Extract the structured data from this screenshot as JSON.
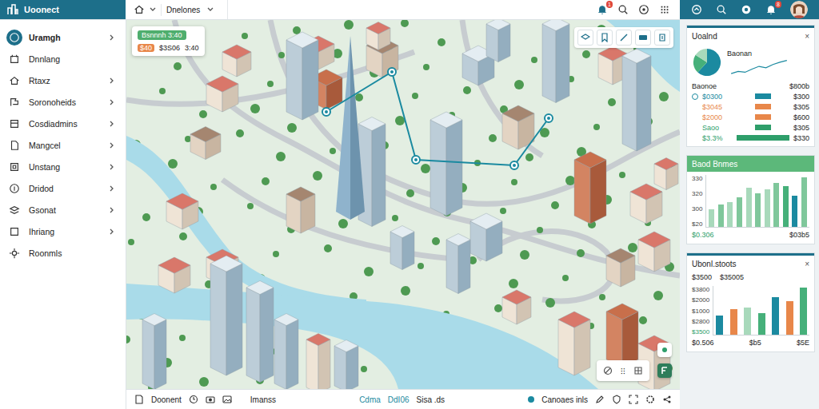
{
  "app": {
    "logo": "Uoonect"
  },
  "breadcrumb": {
    "label": "Dnelones"
  },
  "topbar": {
    "badges": [
      "1",
      "8"
    ]
  },
  "sidebar": {
    "items": [
      {
        "label": "Uramgh",
        "selected": true,
        "expandable": true
      },
      {
        "label": "Dnnlang",
        "selected": false,
        "expandable": false
      },
      {
        "label": "Rtaxz",
        "selected": false,
        "expandable": true
      },
      {
        "label": "Soronoheids",
        "selected": false,
        "expandable": true
      },
      {
        "label": "Cosdiadmins",
        "selected": false,
        "expandable": true
      },
      {
        "label": "Mangcel",
        "selected": false,
        "expandable": true
      },
      {
        "label": "Unstang",
        "selected": false,
        "expandable": true
      },
      {
        "label": "Dridod",
        "selected": false,
        "expandable": true
      },
      {
        "label": "Gsonat",
        "selected": false,
        "expandable": true
      },
      {
        "label": "Ihriang",
        "selected": false,
        "expandable": true
      },
      {
        "label": "Roonmls",
        "selected": false,
        "expandable": false
      }
    ]
  },
  "map": {
    "info_card": {
      "pill": "Bsnnnh 3:40",
      "badge": "$40",
      "info": "$3S06",
      "time": "3:40"
    },
    "legend_card": {
      "label": "⁝⁝"
    }
  },
  "bottom_bar": {
    "doc_label": "Doonent",
    "view_label": "Imanss",
    "status": [
      {
        "label": "Cdma",
        "accent": true
      },
      {
        "label": "DdI06",
        "accent": true
      },
      {
        "label": "Sisa .ds",
        "accent": false
      }
    ],
    "layer_label": "Canoaes inls"
  },
  "overview_card": {
    "title": "Uoalnd",
    "close": "×",
    "subtitle": "Baonan",
    "pie": [
      {
        "value": 62,
        "color": "#1b8aa0"
      },
      {
        "value": 22,
        "color": "#46b07a"
      },
      {
        "value": 16,
        "color": "#a8d9bb"
      }
    ],
    "sparkline": [
      3,
      4,
      3.6,
      5,
      6.2,
      5.6,
      7,
      8,
      8.8
    ],
    "legend_header": {
      "label": "Baonoe",
      "value": "$800b"
    },
    "rows": [
      {
        "label": "$0300",
        "value": "$300",
        "color": "#1b8aa0",
        "level": 0.3,
        "selected": true
      },
      {
        "label": "$3045",
        "value": "$305",
        "color": "#e8874a",
        "level": 0.3,
        "selected": false
      },
      {
        "label": "$2000",
        "value": "$600",
        "color": "#e8874a",
        "level": 0.3,
        "selected": false
      },
      {
        "label": "Saoo",
        "value": "$305",
        "color": "#2e9e6a",
        "level": 0.3,
        "selected": false
      },
      {
        "label": "$3.3%",
        "value": "$330",
        "color": "#2e9e6a",
        "level": 1,
        "selected": false
      }
    ]
  },
  "bar_card": {
    "title": "Baod Bnmes",
    "ticks": [
      "330",
      "320",
      "300",
      "$20"
    ],
    "max": 330,
    "bars": [
      {
        "value": 110,
        "color": "#a8d9bb"
      },
      {
        "value": 140,
        "color": "#7fc79b"
      },
      {
        "value": 160,
        "color": "#a8d9bb"
      },
      {
        "value": 190,
        "color": "#7fc79b"
      },
      {
        "value": 250,
        "color": "#a8d9bb"
      },
      {
        "value": 215,
        "color": "#7fc79b"
      },
      {
        "value": 240,
        "color": "#a8d9bb"
      },
      {
        "value": 280,
        "color": "#7fc79b"
      },
      {
        "value": 260,
        "color": "#46b07a"
      },
      {
        "value": 200,
        "color": "#1b8aa0"
      },
      {
        "value": 315,
        "color": "#7fc79b"
      }
    ],
    "footer": [
      "$0.306",
      "$03b5"
    ]
  },
  "stack_card": {
    "title": "Ubonl.stoots",
    "close": "×",
    "header": [
      "$3500",
      "$35005"
    ],
    "ticks": [
      {
        "label": "$3800",
        "accent": false
      },
      {
        "label": "$2000",
        "accent": false
      },
      {
        "label": "$1000",
        "accent": false
      },
      {
        "label": "$2800",
        "accent": false
      },
      {
        "label": "$3500",
        "accent": true
      }
    ],
    "max": 3800,
    "bars": [
      {
        "value": 1500,
        "color": "#1b8aa0"
      },
      {
        "value": 2000,
        "color": "#e8874a"
      },
      {
        "value": 2100,
        "color": "#a8d9bb"
      },
      {
        "value": 1700,
        "color": "#46b07a"
      },
      {
        "value": 2900,
        "color": "#1b8aa0"
      },
      {
        "value": 2600,
        "color": "#e8874a"
      },
      {
        "value": 3700,
        "color": "#46b07a"
      }
    ],
    "footer": [
      "$0.506",
      "$b5",
      "$5E"
    ]
  }
}
